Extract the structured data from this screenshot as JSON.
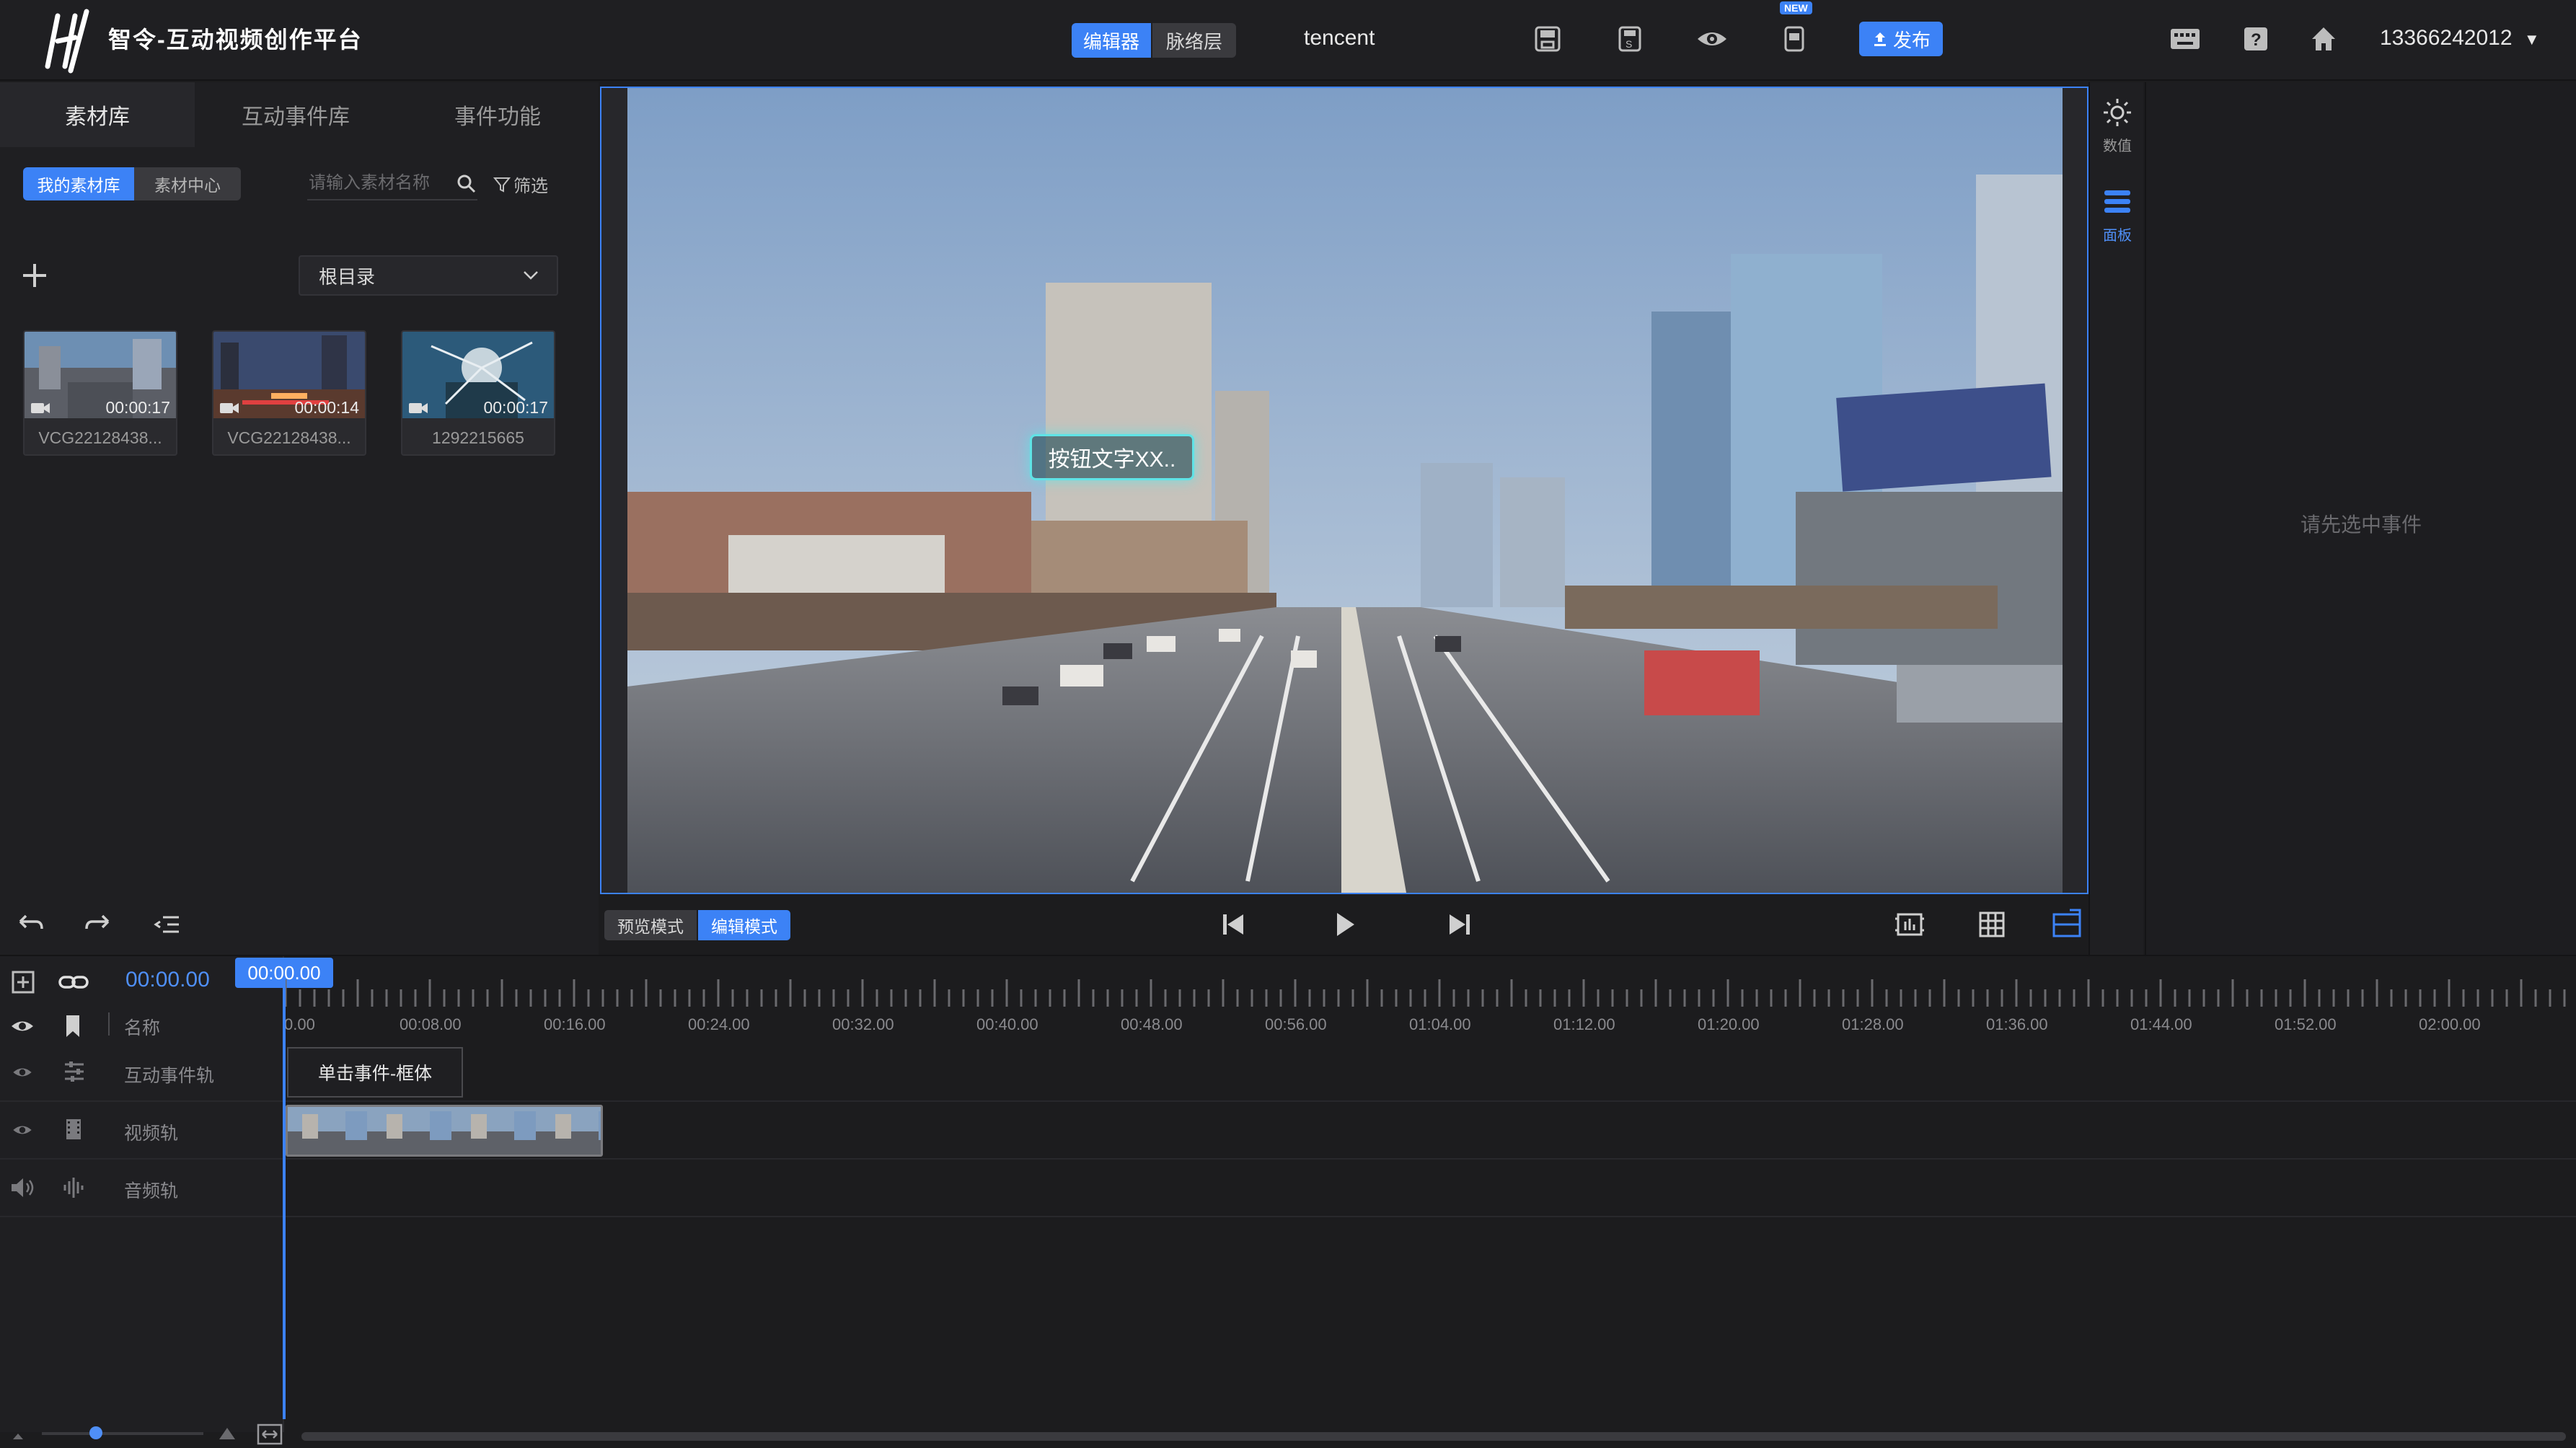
{
  "header": {
    "app_title": "智令-互动视频创作平台",
    "tabs": [
      {
        "label": "编辑器",
        "active": true
      },
      {
        "label": "脉络层",
        "active": false
      }
    ],
    "project_name": "tencent",
    "tools": [
      "save-icon",
      "saved-icon",
      "preview-eye-icon",
      "mobile-preview-icon"
    ],
    "new_badge": "NEW",
    "publish_label": "发布",
    "account": "13366242012"
  },
  "left_panel": {
    "tabs": [
      {
        "label": "素材库",
        "active": true
      },
      {
        "label": "互动事件库"
      },
      {
        "label": "事件功能"
      }
    ],
    "library_toggle": {
      "my": "我的素材库",
      "center": "素材中心"
    },
    "search_placeholder": "请输入素材名称",
    "filter_label": "筛选",
    "folder": "根目录",
    "assets": [
      {
        "duration": "00:00:17",
        "name": "VCG22128438..."
      },
      {
        "duration": "00:00:14",
        "name": "VCG22128438..."
      },
      {
        "duration": "00:00:17",
        "name": "1292215665"
      }
    ]
  },
  "preview": {
    "overlay_button": "按钮文字XX..",
    "modes": {
      "preview": "预览模式",
      "edit": "编辑模式"
    }
  },
  "right_sidebar": {
    "value_label": "数值",
    "panel_label": "面板",
    "empty_hint": "请先选中事件"
  },
  "timeline": {
    "current_time": "00:00.00",
    "playhead": "00:00.00",
    "name_header": "名称",
    "ticks": [
      "0.00",
      "00:08.00",
      "00:16.00",
      "00:24.00",
      "00:32.00",
      "00:40.00",
      "00:48.00",
      "00:56.00",
      "01:04.00",
      "01:12.00",
      "01:20.00",
      "01:28.00",
      "01:36.00",
      "01:44.00",
      "01:52.00",
      "02:00.00"
    ],
    "tracks": [
      {
        "name": "互动事件轨"
      },
      {
        "name": "视频轨"
      },
      {
        "name": "音频轨"
      }
    ],
    "event_clip": "单击事件-框体"
  },
  "colors": {
    "accent": "#3c82f6",
    "glow": "#5fe3e6",
    "bg": "#1c1c1e"
  }
}
